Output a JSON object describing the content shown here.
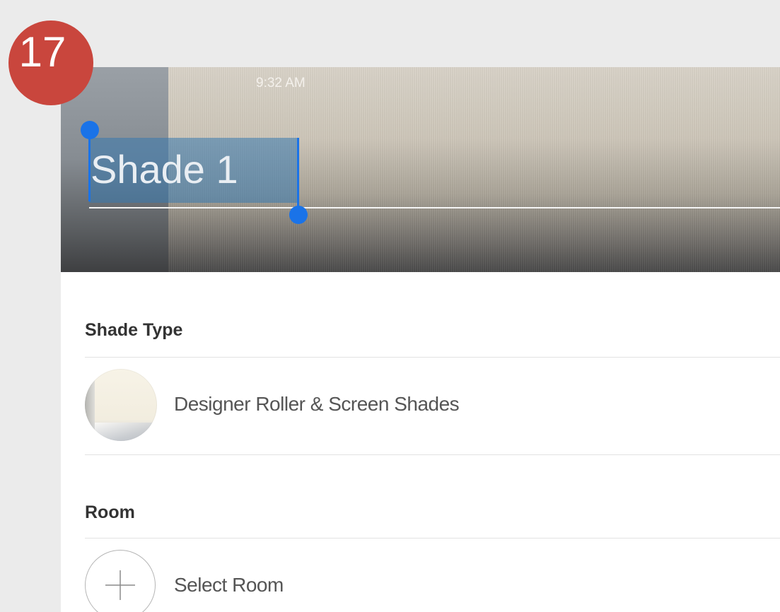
{
  "step_badge": "17",
  "status_bar": {
    "time": "9:32 AM"
  },
  "shade_name": {
    "value": "Shade 1"
  },
  "shade_type": {
    "heading": "Shade Type",
    "selected": "Designer Roller & Screen Shades",
    "icon": "shade-swatch-image"
  },
  "room": {
    "heading": "Room",
    "action": "Select Room",
    "icon": "plus-icon"
  },
  "colors": {
    "badge": "#c9463d",
    "selection": "#3778af",
    "handle": "#1a73e8"
  }
}
